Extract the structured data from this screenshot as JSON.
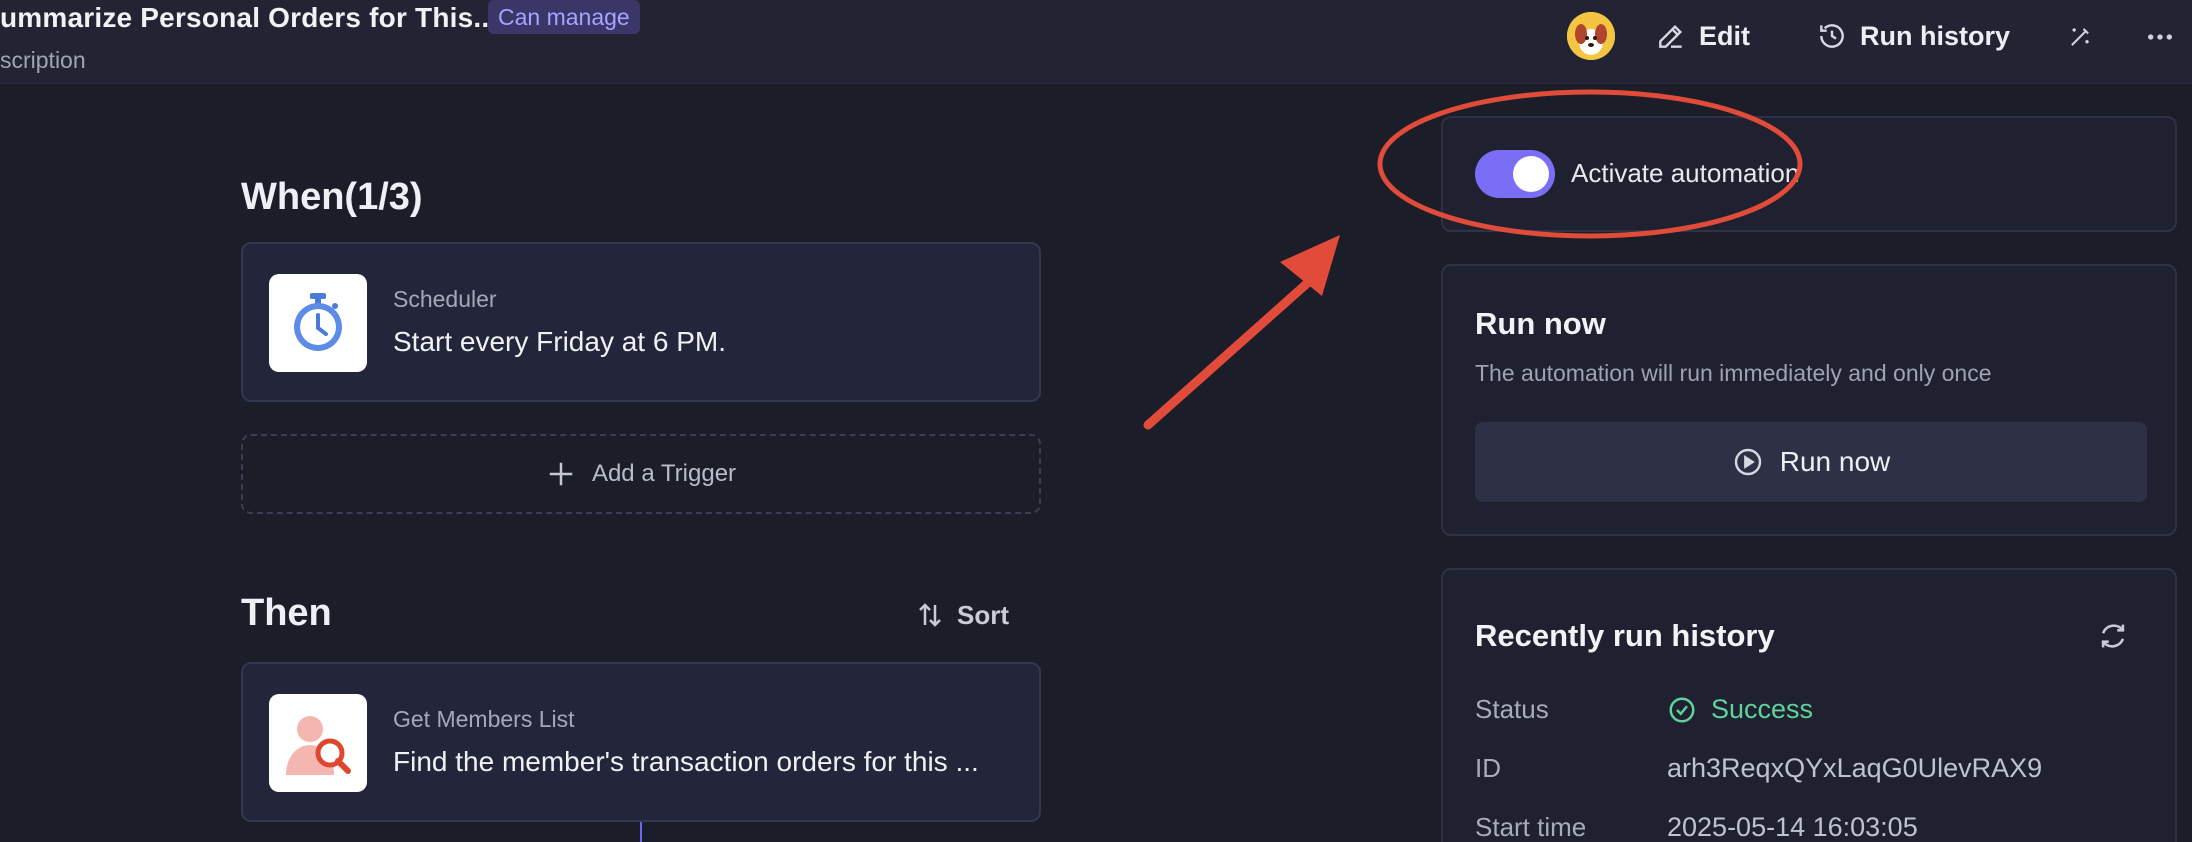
{
  "header": {
    "title": "ummarize Personal Orders for This...",
    "permission_badge": "Can manage",
    "description": "scription",
    "edit_label": "Edit",
    "run_history_label": "Run history"
  },
  "when": {
    "title": "When(1/3)",
    "trigger": {
      "label": "Scheduler",
      "text": "Start every Friday at 6 PM.",
      "icon": "stopwatch-icon"
    },
    "add_trigger_label": "Add a Trigger"
  },
  "then": {
    "title": "Then",
    "sort_label": "Sort",
    "action": {
      "label": "Get Members List",
      "text": "Find the member's transaction orders for this ...",
      "icon": "member-search-icon"
    }
  },
  "activate": {
    "label": "Activate automation",
    "enabled": true
  },
  "run_now": {
    "title": "Run now",
    "description": "The automation will run immediately and only once",
    "button_label": "Run now"
  },
  "history": {
    "title": "Recently run history",
    "rows": [
      {
        "key": "Status",
        "value": "Success"
      },
      {
        "key": "ID",
        "value": "arh3ReqxQYxLaqG0UlevRAX9"
      },
      {
        "key": "Start time",
        "value": "2025-05-14 16:03:05"
      }
    ]
  },
  "colors": {
    "background": "#1b1d28",
    "accent": "#7b6ef6",
    "success": "#5fd39b",
    "annotation": "#e04b3a"
  }
}
